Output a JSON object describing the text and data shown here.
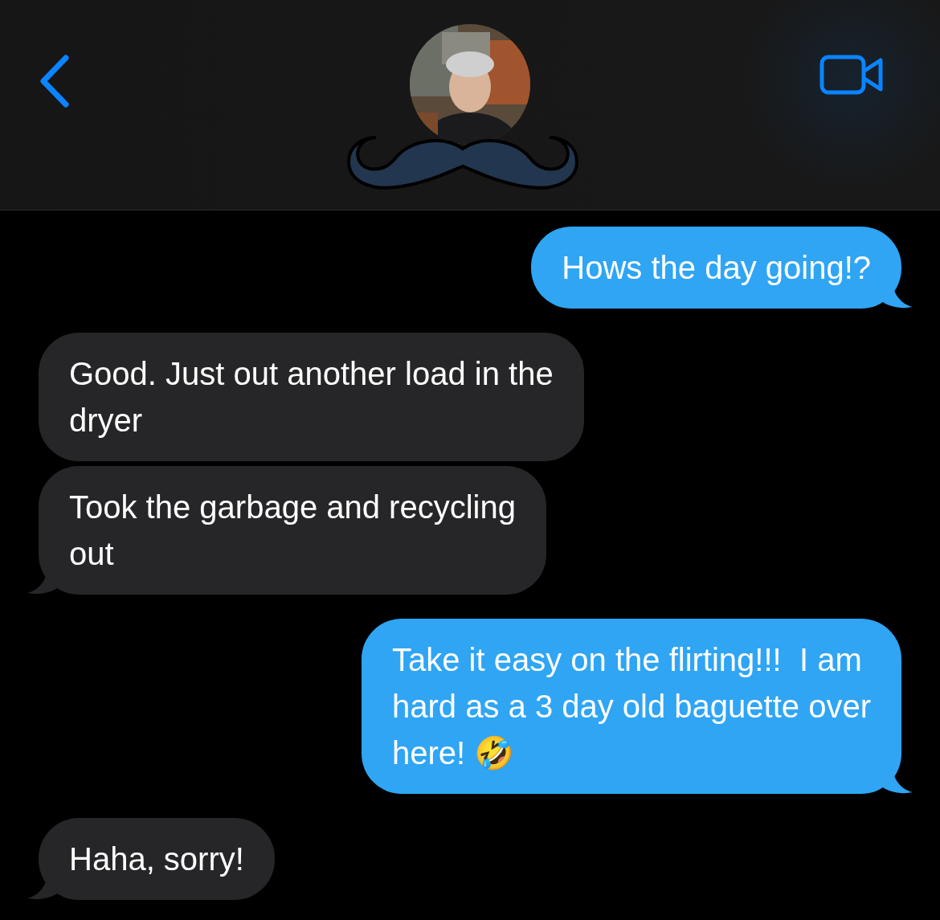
{
  "messages": [
    {
      "kind": "sent",
      "text": "Hows the day going!?",
      "tail": true
    },
    {
      "kind": "received",
      "text": "Good. Just out another load in the\ndryer",
      "tail": false
    },
    {
      "kind": "received",
      "text": "Took the garbage and recycling\nout",
      "tail": true
    },
    {
      "kind": "sent",
      "text": "Take it easy on the flirting!!!  I am\nhard as a 3 day old baguette over\nhere! 🤣",
      "tail": true
    },
    {
      "kind": "received",
      "text": "Haha, sorry!",
      "tail": true
    }
  ]
}
